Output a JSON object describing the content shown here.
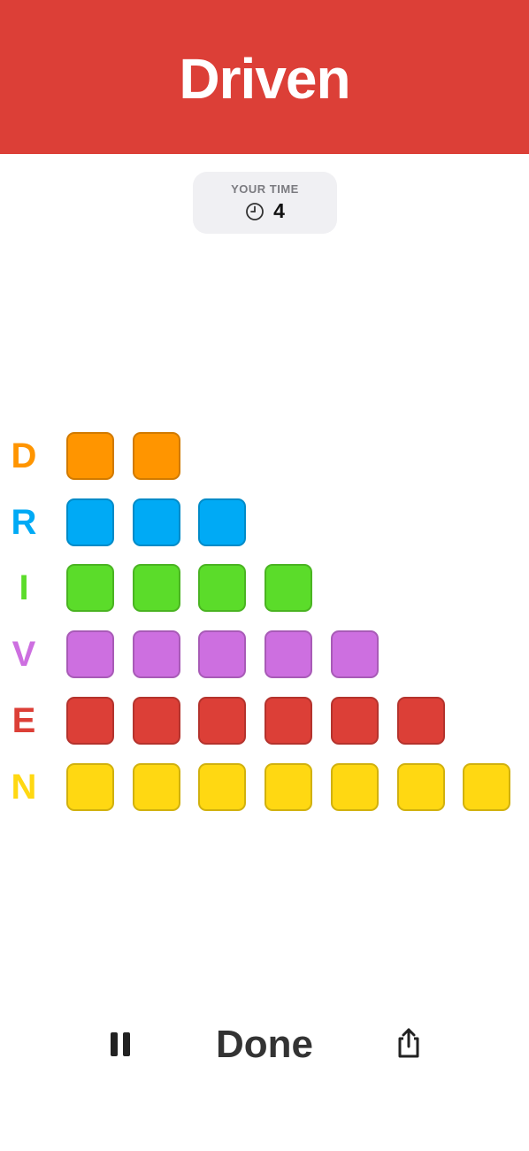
{
  "header": {
    "title": "Driven",
    "bg_color": "#dc3f37"
  },
  "timer": {
    "label": "YOUR TIME",
    "value": "4",
    "icon": "clock-icon"
  },
  "rows": [
    {
      "letter": "D",
      "color": "#ff9500",
      "count": 2
    },
    {
      "letter": "R",
      "color": "#00aaf5",
      "count": 3
    },
    {
      "letter": "I",
      "color": "#5bdc2a",
      "count": 4
    },
    {
      "letter": "V",
      "color": "#cd6fe0",
      "count": 5
    },
    {
      "letter": "E",
      "color": "#dc3f37",
      "count": 6
    },
    {
      "letter": "N",
      "color": "#ffd812",
      "count": 7
    }
  ],
  "toolbar": {
    "pause_icon": "pause-icon",
    "done_label": "Done",
    "share_icon": "share-icon"
  }
}
